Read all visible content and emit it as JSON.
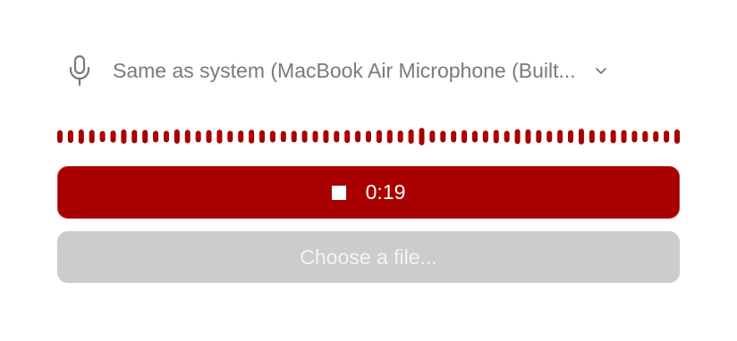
{
  "microphone": {
    "icon": "microphone-icon",
    "selected_label": "Same as system (MacBook Air Microphone (Built...",
    "dropdown_icon": "chevron-down-icon"
  },
  "waveform": {
    "color": "#a80000",
    "levels": [
      0.55,
      0.55,
      0.62,
      0.58,
      0.48,
      0.52,
      0.62,
      0.58,
      0.58,
      0.5,
      0.5,
      0.62,
      0.58,
      0.5,
      0.56,
      0.6,
      0.5,
      0.52,
      0.6,
      0.55,
      0.5,
      0.48,
      0.5,
      0.52,
      0.5,
      0.56,
      0.5,
      0.56,
      0.5,
      0.5,
      0.56,
      0.58,
      0.52,
      0.62,
      0.75,
      0.52,
      0.5,
      0.5,
      0.56,
      0.5,
      0.52,
      0.58,
      0.5,
      0.64,
      0.62,
      0.56,
      0.5,
      0.58,
      0.55,
      0.68,
      0.56,
      0.52,
      0.58,
      0.56,
      0.5,
      0.48,
      0.46,
      0.52,
      0.62
    ]
  },
  "recording": {
    "stop_icon": "stop-icon",
    "elapsed": "0:19",
    "color": "#a80000"
  },
  "file_picker": {
    "label": "Choose a file..."
  }
}
